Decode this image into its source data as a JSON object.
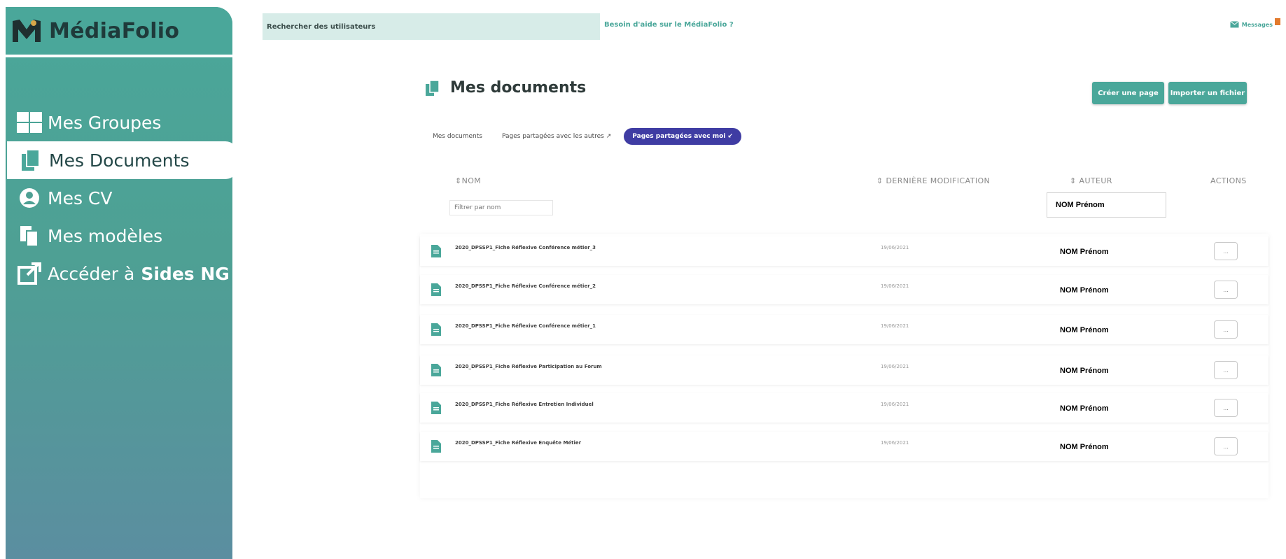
{
  "app": {
    "name": "MédiaFolio"
  },
  "colors": {
    "accent": "#4aa79a",
    "tab_active": "#3f3ca3",
    "search_bg": "#d7ece8"
  },
  "sidebar": {
    "items": [
      {
        "label": "Mes Groupes",
        "icon": "grid-icon",
        "active": false
      },
      {
        "label": "Mes Documents",
        "icon": "documents-icon",
        "active": true
      },
      {
        "label": "Mes CV",
        "icon": "user-circle-icon",
        "active": false
      },
      {
        "label": "Mes modèles",
        "icon": "copy-icon",
        "active": false
      },
      {
        "label": "Accéder à",
        "label_bold": "Sides NG",
        "icon": "external-link-icon",
        "active": false
      }
    ]
  },
  "topbar": {
    "search_label": "Rechercher des utilisateurs",
    "help_link": "Besoin d'aide sur le MédiaFolio ?",
    "messages_label": "Messages"
  },
  "main": {
    "title": "Mes documents",
    "buttons": {
      "create": "Créer une page",
      "import": "Importer un fichier"
    },
    "tabs": [
      {
        "label": "Mes documents",
        "active": false
      },
      {
        "label": "Pages partagées avec les autres",
        "active": false
      },
      {
        "label": "Pages partagées avec moi",
        "active": true
      }
    ],
    "columns": {
      "name": "NOM",
      "modified": "DERNIÈRE MODIFICATION",
      "author": "AUTEUR",
      "actions": "ACTIONS"
    },
    "filters": {
      "name_placeholder": "Filtrer par nom",
      "author_value": "NOM Prénom"
    },
    "rows": [
      {
        "name": "2020_DPSSP1_Fiche Réflexive Conférence métier_3",
        "date": "19/06/2021",
        "author": "NOM Prénom",
        "action": "..."
      },
      {
        "name": "2020_DPSSP1_Fiche Réflexive Conférence métier_2",
        "date": "19/06/2021",
        "author": "NOM Prénom",
        "action": "..."
      },
      {
        "name": "2020_DPSSP1_Fiche Réflexive Conférence métier_1",
        "date": "19/06/2021",
        "author": "NOM Prénom",
        "action": "..."
      },
      {
        "name": "2020_DPSSP1_Fiche Réflexive Participation au Forum",
        "date": "19/06/2021",
        "author": "NOM Prénom",
        "action": "..."
      },
      {
        "name": "2020_DPSSP1_Fiche Réflexive Entretien Individuel",
        "date": "19/06/2021",
        "author": "NOM Prénom",
        "action": "..."
      },
      {
        "name": "2020_DPSSP1_Fiche Réflexive Enquête Métier",
        "date": "19/06/2021",
        "author": "NOM Prénom",
        "action": "..."
      }
    ]
  }
}
